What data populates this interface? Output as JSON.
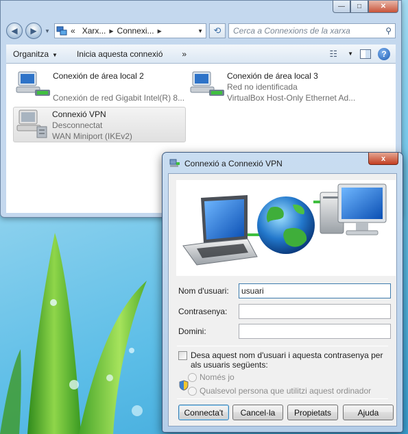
{
  "explorer": {
    "titlebar_buttons": {
      "minimize": "—",
      "maximize": "□",
      "close": "✕"
    },
    "nav": {
      "back_icon": "back-arrow-icon",
      "forward_icon": "forward-arrow-icon"
    },
    "address": {
      "prefix": "«",
      "crumbs": [
        "Xarx...",
        "Connexi..."
      ]
    },
    "search": {
      "placeholder": "Cerca a Connexions de la xarxa"
    },
    "toolbar": {
      "organize": "Organitza",
      "start_connection": "Inicia aquesta connexió",
      "more": "»"
    },
    "connections": [
      {
        "name": "Conexión de área local 2",
        "status": "",
        "device": "Conexión de red Gigabit Intel(R) 8..."
      },
      {
        "name": "Conexión de área local 3",
        "status": "Red no identificada",
        "device": "VirtualBox Host-Only Ethernet Ad..."
      },
      {
        "name": "Connexió VPN",
        "status": "Desconnectat",
        "device": "WAN Miniport (IKEv2)"
      }
    ]
  },
  "dialog": {
    "title": "Connexió a Connexió VPN",
    "close_label": "x",
    "fields": {
      "username_label": "Nom d'usuari:",
      "username_value": "usuari",
      "password_label": "Contrasenya:",
      "password_value": "",
      "domain_label": "Domini:",
      "domain_value": ""
    },
    "save_credentials": "Desa aquest nom d'usuari i aquesta contrasenya per als usuaris següents:",
    "radio_only_me": "Només jo",
    "radio_anyone": "Qualsevol persona que utilitzi aquest ordinador",
    "buttons": {
      "connect": "Connecta't",
      "cancel": "Cancel·la",
      "properties": "Propietats",
      "help": "Ajuda"
    }
  }
}
